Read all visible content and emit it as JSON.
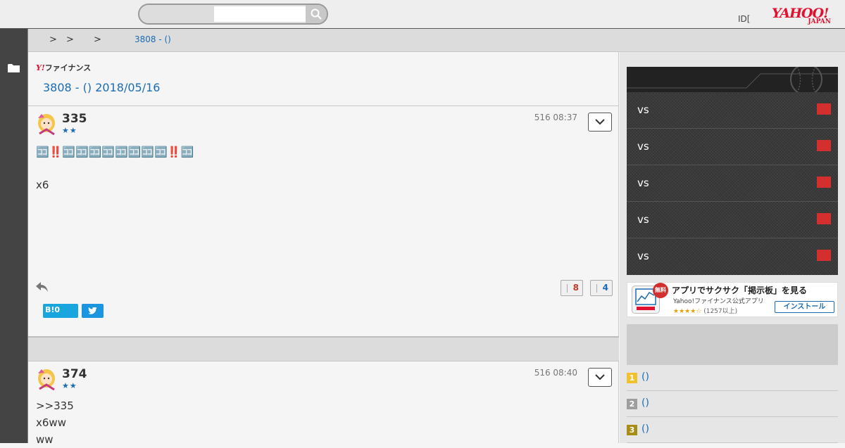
{
  "header": {
    "search_placeholder": "",
    "login_text": "ID[",
    "logo_main": "YAHOO!",
    "logo_sub": "JAPAN"
  },
  "breadcrumb": {
    "separators": [
      ">",
      ">",
      ">"
    ],
    "current": "3808 - ()"
  },
  "thread": {
    "brand_y": "Y!",
    "brand_text": "ファイナンス",
    "title": "3808 - () 2018/05/16"
  },
  "posts": [
    {
      "number": "335",
      "stars": "★★",
      "time": "516 08:37",
      "lines": [
        "🈁‼️🈁🈁🈁🈁🈁🈁🈁🈁‼️🈁",
        "",
        "x6"
      ],
      "likes": "8",
      "dislikes": "4",
      "hatena_label": "B!0"
    },
    {
      "number": "374",
      "stars": "★★",
      "time": "516 08:40",
      "lines": [
        ">>335",
        "x6ww",
        "ww"
      ]
    }
  ],
  "sidebar": {
    "games": [
      {
        "label": "vs"
      },
      {
        "label": "vs"
      },
      {
        "label": "vs"
      },
      {
        "label": "vs"
      },
      {
        "label": "vs"
      }
    ],
    "app_banner": {
      "free_badge": "無料",
      "title": "アプリでサクサク「掲示板」を見る",
      "subtitle": "Yahoo!ファイナンス公式アプリ",
      "stars": "★★★★☆",
      "rating_count": "(1257以上)",
      "install_label": "インストール"
    },
    "ranking": [
      {
        "rank": "1",
        "label": "()",
        "color": "#f2c12e"
      },
      {
        "rank": "2",
        "label": "()",
        "color": "#9e9e9e"
      },
      {
        "rank": "3",
        "label": "()",
        "color": "#a88d14"
      }
    ]
  },
  "colors": {
    "link_blue": "#1a6cb4",
    "brand_red": "#e0102f",
    "live_red": "#d32f2f"
  }
}
